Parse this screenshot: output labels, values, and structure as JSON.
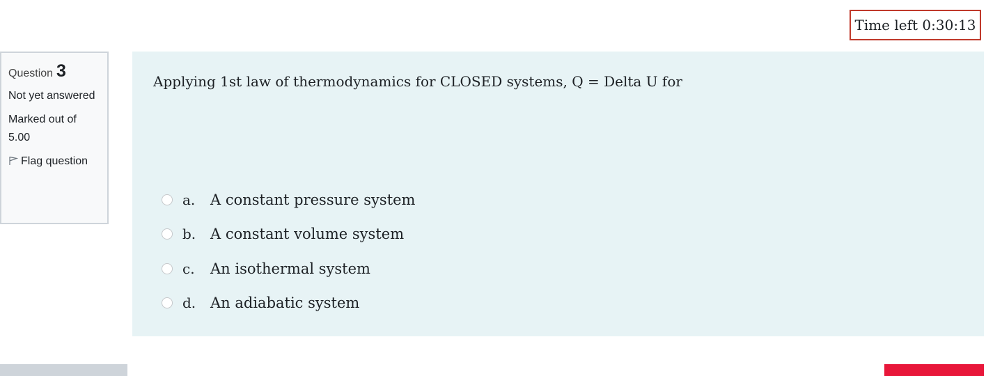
{
  "timer": {
    "label": "Time left 0:30:13"
  },
  "info": {
    "question_label": "Question",
    "question_number": "3",
    "state": "Not yet answered",
    "grade": "Marked out of 5.00",
    "flag_label": "Flag question"
  },
  "question": {
    "text": "Applying 1st law of thermodynamics for CLOSED systems, Q = Delta U for",
    "options": [
      {
        "letter": "a.",
        "text": "A constant pressure system"
      },
      {
        "letter": "b.",
        "text": "A constant volume system"
      },
      {
        "letter": "c.",
        "text": "An isothermal system"
      },
      {
        "letter": "d.",
        "text": "An adiabatic system"
      }
    ]
  },
  "icons": {
    "flag": "flag-icon"
  },
  "colors": {
    "timer_border": "#c0392b",
    "content_bg": "#e7f3f5",
    "next_button": "#e8173a",
    "prev_button": "#ced4da"
  }
}
